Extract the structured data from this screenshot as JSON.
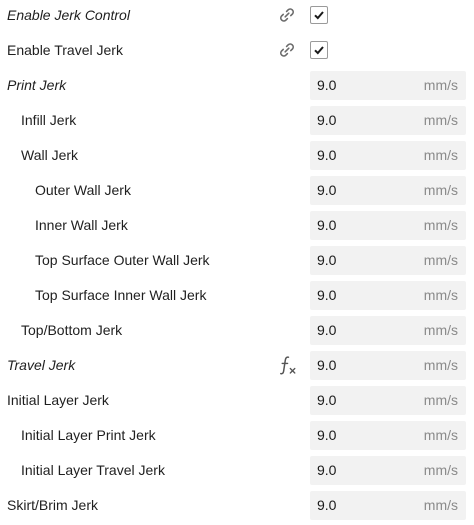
{
  "settings": {
    "enable_jerk_control": {
      "label": "Enable Jerk Control",
      "checked": true,
      "icon": "link-icon"
    },
    "enable_travel_jerk": {
      "label": "Enable Travel Jerk",
      "checked": true,
      "icon": "link-icon"
    },
    "rows": [
      {
        "label": "Print Jerk",
        "value": "9.0",
        "unit": "mm/s"
      },
      {
        "label": "Infill Jerk",
        "value": "9.0",
        "unit": "mm/s"
      },
      {
        "label": "Wall Jerk",
        "value": "9.0",
        "unit": "mm/s"
      },
      {
        "label": "Outer Wall Jerk",
        "value": "9.0",
        "unit": "mm/s"
      },
      {
        "label": "Inner Wall Jerk",
        "value": "9.0",
        "unit": "mm/s"
      },
      {
        "label": "Top Surface Outer Wall Jerk",
        "value": "9.0",
        "unit": "mm/s"
      },
      {
        "label": "Top Surface Inner Wall Jerk",
        "value": "9.0",
        "unit": "mm/s"
      },
      {
        "label": "Top/Bottom Jerk",
        "value": "9.0",
        "unit": "mm/s"
      },
      {
        "label": "Travel Jerk",
        "value": "9.0",
        "unit": "mm/s",
        "icon": "function-icon"
      },
      {
        "label": "Initial Layer Jerk",
        "value": "9.0",
        "unit": "mm/s"
      },
      {
        "label": "Initial Layer Print Jerk",
        "value": "9.0",
        "unit": "mm/s"
      },
      {
        "label": "Initial Layer Travel Jerk",
        "value": "9.0",
        "unit": "mm/s"
      },
      {
        "label": "Skirt/Brim Jerk",
        "value": "9.0",
        "unit": "mm/s"
      }
    ]
  }
}
